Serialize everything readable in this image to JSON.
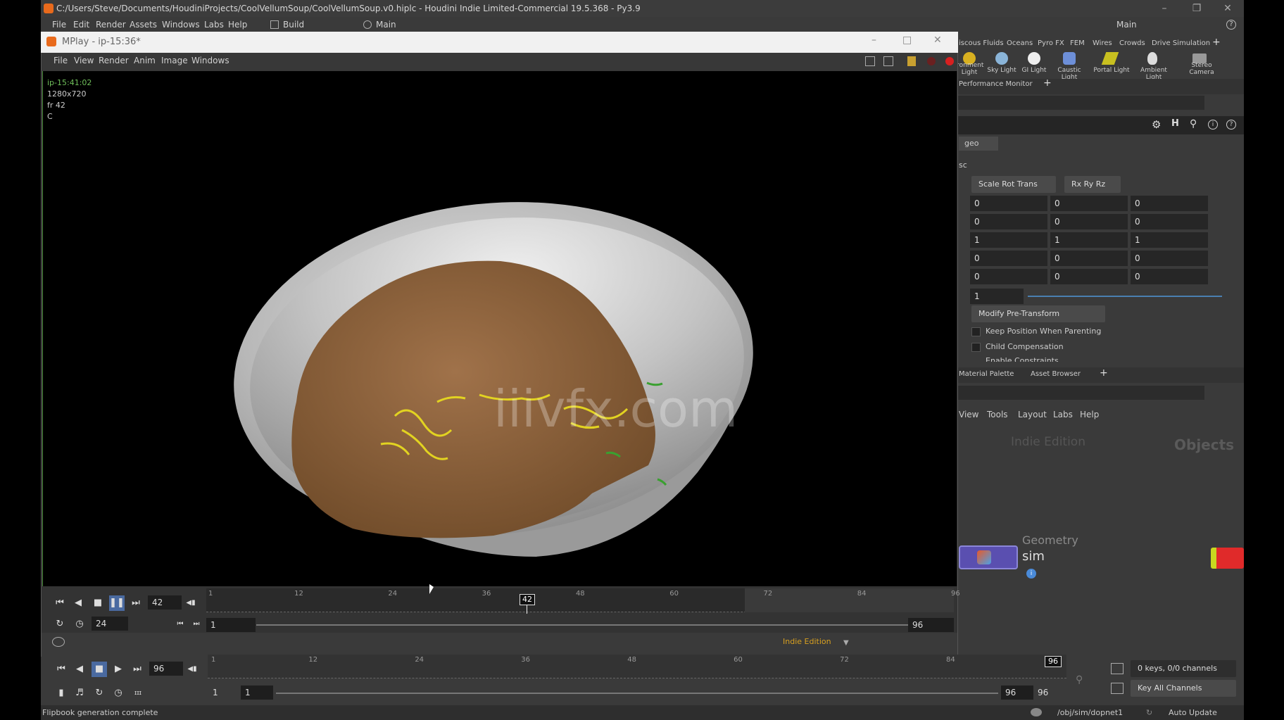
{
  "window": {
    "title": "C:/Users/Steve/Documents/HoudiniProjects/CoolVellumSoup/CoolVellumSoup.v0.hiplc - Houdini Indie Limited-Commercial 19.5.368 - Py3.9"
  },
  "main_menu": {
    "items": [
      "File",
      "Edit",
      "Render",
      "Assets",
      "Windows",
      "Labs",
      "Help"
    ],
    "desktop": "Build",
    "network_name": "Main",
    "right_desktop": "Main"
  },
  "mplay": {
    "title": "MPlay - ip-15:36*",
    "menu": [
      "File",
      "View",
      "Render",
      "Anim",
      "Image",
      "Windows"
    ],
    "info": {
      "name": "ip-15:41:02",
      "resolution": "1280x720",
      "frame": "fr 42",
      "channel": "C"
    },
    "watermark": "iiivfx.com",
    "timeline": {
      "current_frame": "42",
      "fps": "24",
      "range_start": "1",
      "range_end": "96",
      "ticks": [
        "1",
        "12",
        "24",
        "36",
        "48",
        "60",
        "72",
        "84",
        "96"
      ],
      "marker": "42",
      "edition": "Indie Edition"
    }
  },
  "main_timeline": {
    "current_frame": "96",
    "ticks": [
      "1",
      "12",
      "24",
      "36",
      "48",
      "60",
      "72",
      "84"
    ],
    "marker": "96",
    "start": "1",
    "start2": "1",
    "end": "96",
    "end2": "96",
    "keys_info": "0 keys, 0/0 channels",
    "key_all": "Key All Channels"
  },
  "shelf": {
    "tabs": [
      "iscous Fluids",
      "Oceans",
      "Pyro FX",
      "FEM",
      "Wires",
      "Crowds",
      "Drive Simulation"
    ],
    "tools": [
      "ironment\nLight",
      "Sky Light",
      "GI Light",
      "Caustic Light",
      "Portal Light",
      "Ambient Light",
      "Stereo\nCamera"
    ]
  },
  "params": {
    "pane_tab": "Performance Monitor",
    "node_type": "geo",
    "tab": "sc",
    "transform_order": "Scale Rot Trans",
    "rot_order": "Rx Ry Rz",
    "rows": [
      [
        "0",
        "0",
        "0"
      ],
      [
        "0",
        "0",
        "0"
      ],
      [
        "1",
        "1",
        "1"
      ],
      [
        "0",
        "0",
        "0"
      ],
      [
        "0",
        "0",
        "0"
      ]
    ],
    "uniform_scale": "1",
    "pre_transform": "Modify Pre-Transform",
    "checkboxes": [
      "Keep Position When Parenting",
      "Child Compensation",
      "Enable Constraints"
    ]
  },
  "network": {
    "tabs": [
      "Material Palette",
      "Asset Browser"
    ],
    "menu": [
      "View",
      "Tools",
      "Layout",
      "Labs",
      "Help"
    ],
    "edition_watermark": "Indie Edition",
    "context_label": "Objects",
    "node_type": "Geometry",
    "node_name": "sim"
  },
  "status": {
    "message": "Flipbook generation complete",
    "path": "/obj/sim/dopnet1",
    "update_mode": "Auto Update"
  },
  "colors": {
    "bg": "#3a3a3a",
    "accent_green": "#3e8a33",
    "soup": "#8b5e34",
    "bowl": "#c8c8c8",
    "noodle": "#e2d321"
  }
}
